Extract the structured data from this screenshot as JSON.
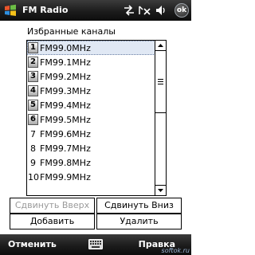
{
  "title_bar": {
    "app_title": "FM Radio",
    "ok_label": "ok",
    "icons": [
      "windows-start-icon",
      "connectivity-arrows-icon",
      "no-signal-icon",
      "speaker-icon"
    ]
  },
  "favorites": {
    "label": "Избранные каналы",
    "items": [
      {
        "num": "1",
        "freq": "FM99.0MHz",
        "badge": true,
        "selected": true
      },
      {
        "num": "2",
        "freq": "FM99.1MHz",
        "badge": true,
        "selected": false
      },
      {
        "num": "3",
        "freq": "FM99.2MHz",
        "badge": true,
        "selected": false
      },
      {
        "num": "4",
        "freq": "FM99.3MHz",
        "badge": true,
        "selected": false
      },
      {
        "num": "5",
        "freq": "FM99.4MHz",
        "badge": true,
        "selected": false
      },
      {
        "num": "6",
        "freq": "FM99.5MHz",
        "badge": true,
        "selected": false
      },
      {
        "num": "7",
        "freq": "FM99.6MHz",
        "badge": false,
        "selected": false
      },
      {
        "num": "8",
        "freq": "FM99.7MHz",
        "badge": false,
        "selected": false
      },
      {
        "num": "9",
        "freq": "FM99.8MHz",
        "badge": false,
        "selected": false
      },
      {
        "num": "10",
        "freq": "FM99.9MHz",
        "badge": false,
        "selected": false
      }
    ]
  },
  "buttons": {
    "move_up": "Сдвинуть Вверх",
    "move_down": "Сдвинуть Вниз",
    "add": "Добавить",
    "delete": "Удалить"
  },
  "menu_bar": {
    "left": "Отменить",
    "right": "Правка",
    "watermark": "softok.ru"
  },
  "colors": {
    "bar_background": "#1c1c1c",
    "selection": "#e0e8f4",
    "disabled_text": "#9a9a9a"
  }
}
